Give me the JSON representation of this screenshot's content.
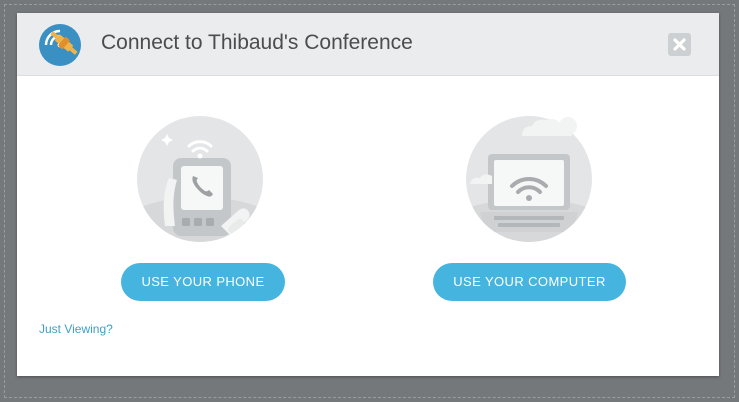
{
  "dialog": {
    "title": "Connect to Thibaud's Conference",
    "logo_icon": "conference-satellite-logo",
    "close_icon": "close-icon"
  },
  "options": {
    "phone": {
      "button_label": "USE YOUR PHONE",
      "illustration": "phone-illustration"
    },
    "computer": {
      "button_label": "USE YOUR COMPUTER",
      "illustration": "computer-illustration"
    }
  },
  "footer": {
    "just_viewing_label": "Just Viewing?"
  },
  "colors": {
    "accent": "#45b5e0",
    "link": "#3f9fc8",
    "header_bg": "#ebeced",
    "title_text": "#4a4d50",
    "backdrop": "#75787b"
  }
}
